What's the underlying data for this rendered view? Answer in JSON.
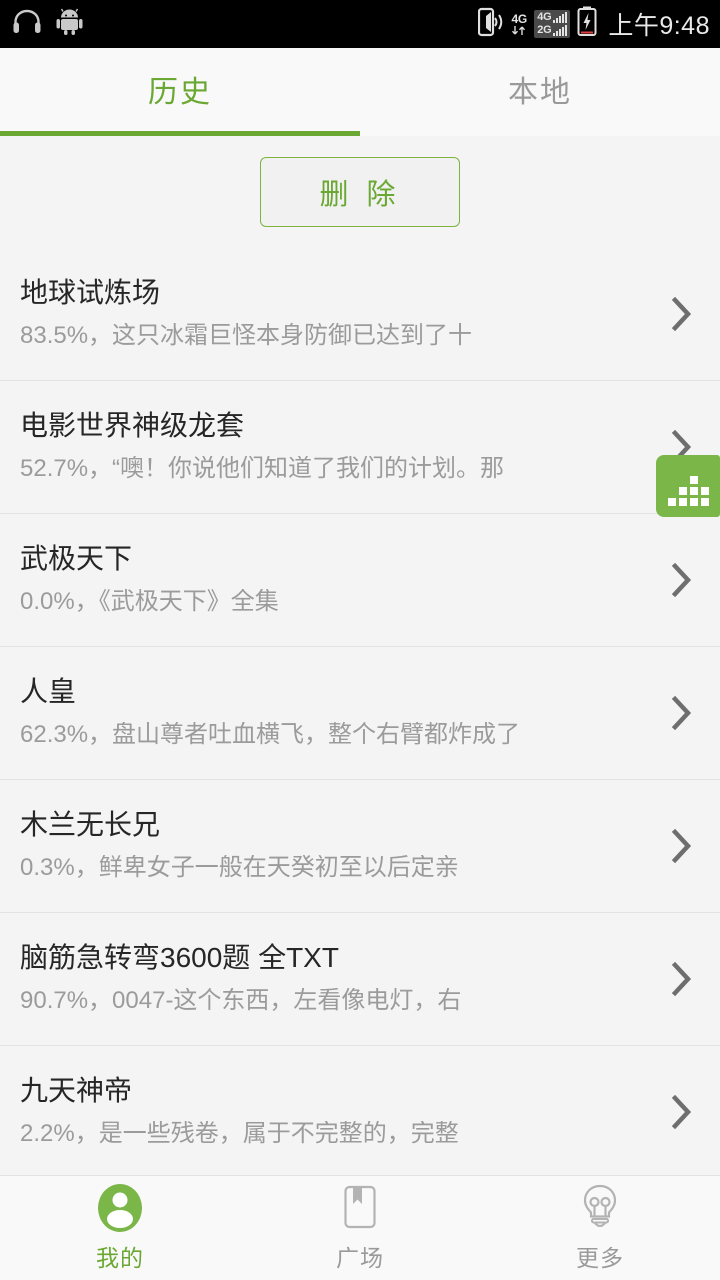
{
  "statusbar": {
    "headphone_icon": "headphone-icon",
    "android_icon": "android-robot-icon",
    "vibrate_icon": "phone-vibrate-icon",
    "network_label_small": "4G",
    "sim1_label": "4G",
    "sim2_label": "2G",
    "battery_icon": "battery-charging-icon",
    "time": "上午9:48"
  },
  "tabs": {
    "items": [
      {
        "label": "历史",
        "active": true
      },
      {
        "label": "本地",
        "active": false
      }
    ],
    "accent_color": "#6aa833"
  },
  "toolbar": {
    "delete_label": "删 除"
  },
  "list": {
    "chevron_icon": "chevron-right-icon",
    "items": [
      {
        "title": "地球试炼场",
        "subtitle": "83.5%，这只冰霜巨怪本身防御已达到了十"
      },
      {
        "title": "电影世界神级龙套",
        "subtitle": "52.7%，“噢！你说他们知道了我们的计划。那"
      },
      {
        "title": "武极天下",
        "subtitle": "0.0%，《武极天下》全集"
      },
      {
        "title": "人皇",
        "subtitle": "62.3%，盘山尊者吐血横飞，整个右臂都炸成了"
      },
      {
        "title": "木兰无长兄",
        "subtitle": "0.3%，鲜卑女子一般在天癸初至以后定亲"
      },
      {
        "title": "脑筋急转弯3600题 全TXT",
        "subtitle": "90.7%，0047-这个东西，左看像电灯，右"
      },
      {
        "title": "九天神帝",
        "subtitle": "2.2%，是一些残卷，属于不完整的，完整"
      }
    ]
  },
  "floating_widget": {
    "icon": "bar-chart-squares-icon",
    "color": "#7ab648"
  },
  "bottomnav": {
    "items": [
      {
        "label": "我的",
        "icon": "person-circle-icon",
        "active": true
      },
      {
        "label": "广场",
        "icon": "bookmark-book-icon",
        "active": false
      },
      {
        "label": "更多",
        "icon": "lightbulb-icon",
        "active": false
      }
    ]
  }
}
